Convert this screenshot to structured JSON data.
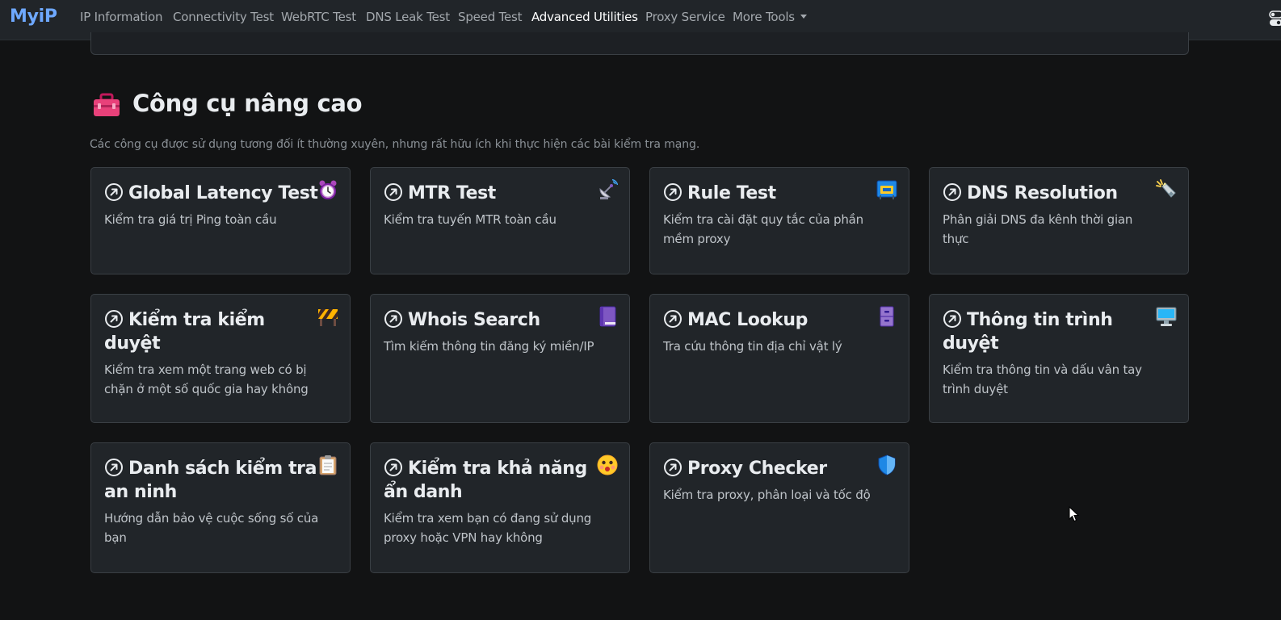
{
  "nav": {
    "brand": "MyiP",
    "items": [
      {
        "label": "IP Information"
      },
      {
        "label": "Connectivity Test"
      },
      {
        "label": "WebRTC Test"
      },
      {
        "label": "DNS Leak Test"
      },
      {
        "label": "Speed Test"
      },
      {
        "label": "Advanced Utilities",
        "active": true
      },
      {
        "label": "Proxy Service"
      },
      {
        "label": "More Tools"
      }
    ]
  },
  "section": {
    "icon": "toolbox-icon",
    "title": "Công cụ nâng cao",
    "description": "Các công cụ được sử dụng tương đối ít thường xuyên, nhưng rất hữu ích khi thực hiện các bài kiểm tra mạng."
  },
  "cards": [
    {
      "title": "Global Latency Test",
      "description": "Kiểm tra giá trị Ping toàn cầu",
      "icon": "alarm-clock-icon"
    },
    {
      "title": "MTR Test",
      "description": "Kiểm tra tuyến MTR toàn cầu",
      "icon": "satellite-dish-icon"
    },
    {
      "title": "Rule Test",
      "description": "Kiểm tra cài đặt quy tắc của phần mềm proxy",
      "icon": "control-knobs-icon"
    },
    {
      "title": "DNS Resolution",
      "description": "Phân giải DNS đa kênh thời gian thực",
      "icon": "flashlight-icon"
    },
    {
      "title": "Kiểm tra kiểm duyệt",
      "description": "Kiểm tra xem một trang web có bị chặn ở một số quốc gia hay không",
      "icon": "construction-barrier-icon"
    },
    {
      "title": "Whois Search",
      "description": "Tìm kiếm thông tin đăng ký miền/IP",
      "icon": "notebook-icon"
    },
    {
      "title": "MAC Lookup",
      "description": "Tra cứu thông tin địa chỉ vật lý",
      "icon": "file-cabinet-icon"
    },
    {
      "title": "Thông tin trình duyệt",
      "description": "Kiểm tra thông tin và dấu vân tay trình duyệt",
      "icon": "desktop-computer-icon"
    },
    {
      "title": "Danh sách kiểm tra an ninh",
      "description": "Hướng dẫn bảo vệ cuộc sống số của bạn",
      "icon": "clipboard-icon"
    },
    {
      "title": "Kiểm tra khả năng ẩn danh",
      "description": "Kiểm tra xem bạn có đang sử dụng proxy hoặc VPN hay không",
      "icon": "surprised-face-icon"
    },
    {
      "title": "Proxy Checker",
      "description": "Kiểm tra proxy, phân loại và tốc độ",
      "icon": "shield-icon"
    }
  ]
}
